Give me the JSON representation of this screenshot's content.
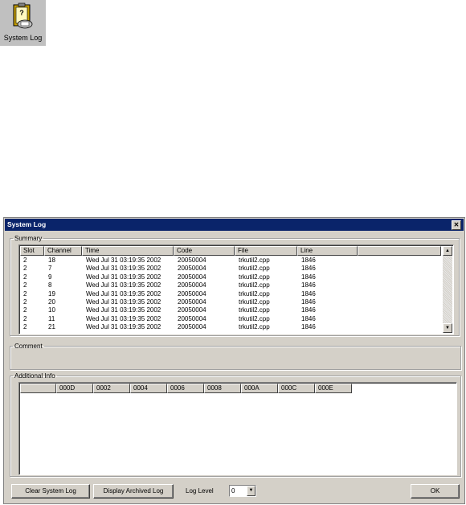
{
  "desktop_icon": {
    "label": "System Log",
    "icon": "clipboard-phone-icon"
  },
  "window": {
    "title": "System Log",
    "summary": {
      "legend": "Summary",
      "columns": [
        "Slot",
        "Channel",
        "Time",
        "Code",
        "File",
        "Line"
      ],
      "rows": [
        [
          "2",
          "18",
          "Wed Jul 31 03:19:35 2002",
          "20050004",
          "trkutil2.cpp",
          "1846"
        ],
        [
          "2",
          "7",
          "Wed Jul 31 03:19:35 2002",
          "20050004",
          "trkutil2.cpp",
          "1846"
        ],
        [
          "2",
          "9",
          "Wed Jul 31 03:19:35 2002",
          "20050004",
          "trkutil2.cpp",
          "1846"
        ],
        [
          "2",
          "8",
          "Wed Jul 31 03:19:35 2002",
          "20050004",
          "trkutil2.cpp",
          "1846"
        ],
        [
          "2",
          "19",
          "Wed Jul 31 03:19:35 2002",
          "20050004",
          "trkutil2.cpp",
          "1846"
        ],
        [
          "2",
          "20",
          "Wed Jul 31 03:19:35 2002",
          "20050004",
          "trkutil2.cpp",
          "1846"
        ],
        [
          "2",
          "10",
          "Wed Jul 31 03:19:35 2002",
          "20050004",
          "trkutil2.cpp",
          "1846"
        ],
        [
          "2",
          "11",
          "Wed Jul 31 03:19:35 2002",
          "20050004",
          "trkutil2.cpp",
          "1846"
        ],
        [
          "2",
          "21",
          "Wed Jul 31 03:19:35 2002",
          "20050004",
          "trkutil2.cpp",
          "1846"
        ]
      ]
    },
    "comment": {
      "legend": "Comment"
    },
    "additional": {
      "legend": "Additional Info",
      "columns": [
        "",
        "000D",
        "0002",
        "0004",
        "0006",
        "0008",
        "000A",
        "000C",
        "000E"
      ]
    },
    "buttons": {
      "clear": "Clear System Log",
      "archived": "Display Archived Log",
      "ok": "OK"
    },
    "log_level": {
      "label": "Log Level",
      "value": "0"
    }
  }
}
